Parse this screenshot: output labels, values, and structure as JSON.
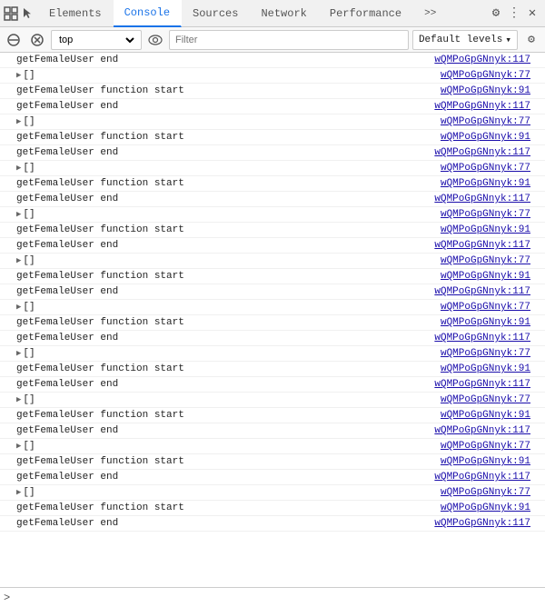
{
  "tabs": [
    {
      "id": "elements",
      "label": "Elements",
      "active": false
    },
    {
      "id": "console",
      "label": "Console",
      "active": true
    },
    {
      "id": "sources",
      "label": "Sources",
      "active": false
    },
    {
      "id": "network",
      "label": "Network",
      "active": false
    },
    {
      "id": "performance",
      "label": "Performance",
      "active": false
    }
  ],
  "toolbar": {
    "context": "top",
    "filter_placeholder": "Filter",
    "levels_label": "Default levels",
    "more_tabs_label": ">>"
  },
  "console_rows": [
    {
      "type": "text",
      "text": "getFemaleUser end",
      "link": "wQMPoGpGNnyk:117"
    },
    {
      "type": "array",
      "text": "[]",
      "link": "wQMPoGpGNnyk:77"
    },
    {
      "type": "text",
      "text": "getFemaleUser function start",
      "link": "wQMPoGpGNnyk:91"
    },
    {
      "type": "text",
      "text": "getFemaleUser end",
      "link": "wQMPoGpGNnyk:117"
    },
    {
      "type": "array",
      "text": "[]",
      "link": "wQMPoGpGNnyk:77"
    },
    {
      "type": "text",
      "text": "getFemaleUser function start",
      "link": "wQMPoGpGNnyk:91"
    },
    {
      "type": "text",
      "text": "getFemaleUser end",
      "link": "wQMPoGpGNnyk:117"
    },
    {
      "type": "array",
      "text": "[]",
      "link": "wQMPoGpGNnyk:77"
    },
    {
      "type": "text",
      "text": "getFemaleUser function start",
      "link": "wQMPoGpGNnyk:91"
    },
    {
      "type": "text",
      "text": "getFemaleUser end",
      "link": "wQMPoGpGNnyk:117"
    },
    {
      "type": "array",
      "text": "[]",
      "link": "wQMPoGpGNnyk:77"
    },
    {
      "type": "text",
      "text": "getFemaleUser function start",
      "link": "wQMPoGpGNnyk:91"
    },
    {
      "type": "text",
      "text": "getFemaleUser end",
      "link": "wQMPoGpGNnyk:117"
    },
    {
      "type": "array",
      "text": "[]",
      "link": "wQMPoGpGNnyk:77"
    },
    {
      "type": "text",
      "text": "getFemaleUser function start",
      "link": "wQMPoGpGNnyk:91"
    },
    {
      "type": "text",
      "text": "getFemaleUser end",
      "link": "wQMPoGpGNnyk:117"
    },
    {
      "type": "array",
      "text": "[]",
      "link": "wQMPoGpGNnyk:77"
    },
    {
      "type": "text",
      "text": "getFemaleUser function start",
      "link": "wQMPoGpGNnyk:91"
    },
    {
      "type": "text",
      "text": "getFemaleUser end",
      "link": "wQMPoGpGNnyk:117"
    },
    {
      "type": "array",
      "text": "[]",
      "link": "wQMPoGpGNnyk:77"
    },
    {
      "type": "text",
      "text": "getFemaleUser function start",
      "link": "wQMPoGpGNnyk:91"
    },
    {
      "type": "text",
      "text": "getFemaleUser end",
      "link": "wQMPoGpGNnyk:117"
    },
    {
      "type": "array",
      "text": "[]",
      "link": "wQMPoGpGNnyk:77"
    },
    {
      "type": "text",
      "text": "getFemaleUser function start",
      "link": "wQMPoGpGNnyk:91"
    },
    {
      "type": "text",
      "text": "getFemaleUser end",
      "link": "wQMPoGpGNnyk:117"
    },
    {
      "type": "array",
      "text": "[]",
      "link": "wQMPoGpGNnyk:77"
    },
    {
      "type": "text",
      "text": "getFemaleUser function start",
      "link": "wQMPoGpGNnyk:91"
    },
    {
      "type": "text",
      "text": "getFemaleUser end",
      "link": "wQMPoGpGNnyk:117"
    },
    {
      "type": "array",
      "text": "[]",
      "link": "wQMPoGpGNnyk:77"
    },
    {
      "type": "text",
      "text": "getFemaleUser function start",
      "link": "wQMPoGpGNnyk:91"
    },
    {
      "type": "text",
      "text": "getFemaleUser end",
      "link": "wQMPoGpGNnyk:117"
    }
  ],
  "console_input": {
    "prompt": ">"
  },
  "icons": {
    "inspect": "⬚",
    "cursor": "☰",
    "more_tabs": "»",
    "settings": "⚙",
    "more_options": "⋮",
    "close": "✕",
    "stop": "⊘",
    "clear": "🚫",
    "eye": "👁",
    "caret_down": "▾",
    "chevron_right": "▶",
    "settings_gear": "⚙"
  }
}
